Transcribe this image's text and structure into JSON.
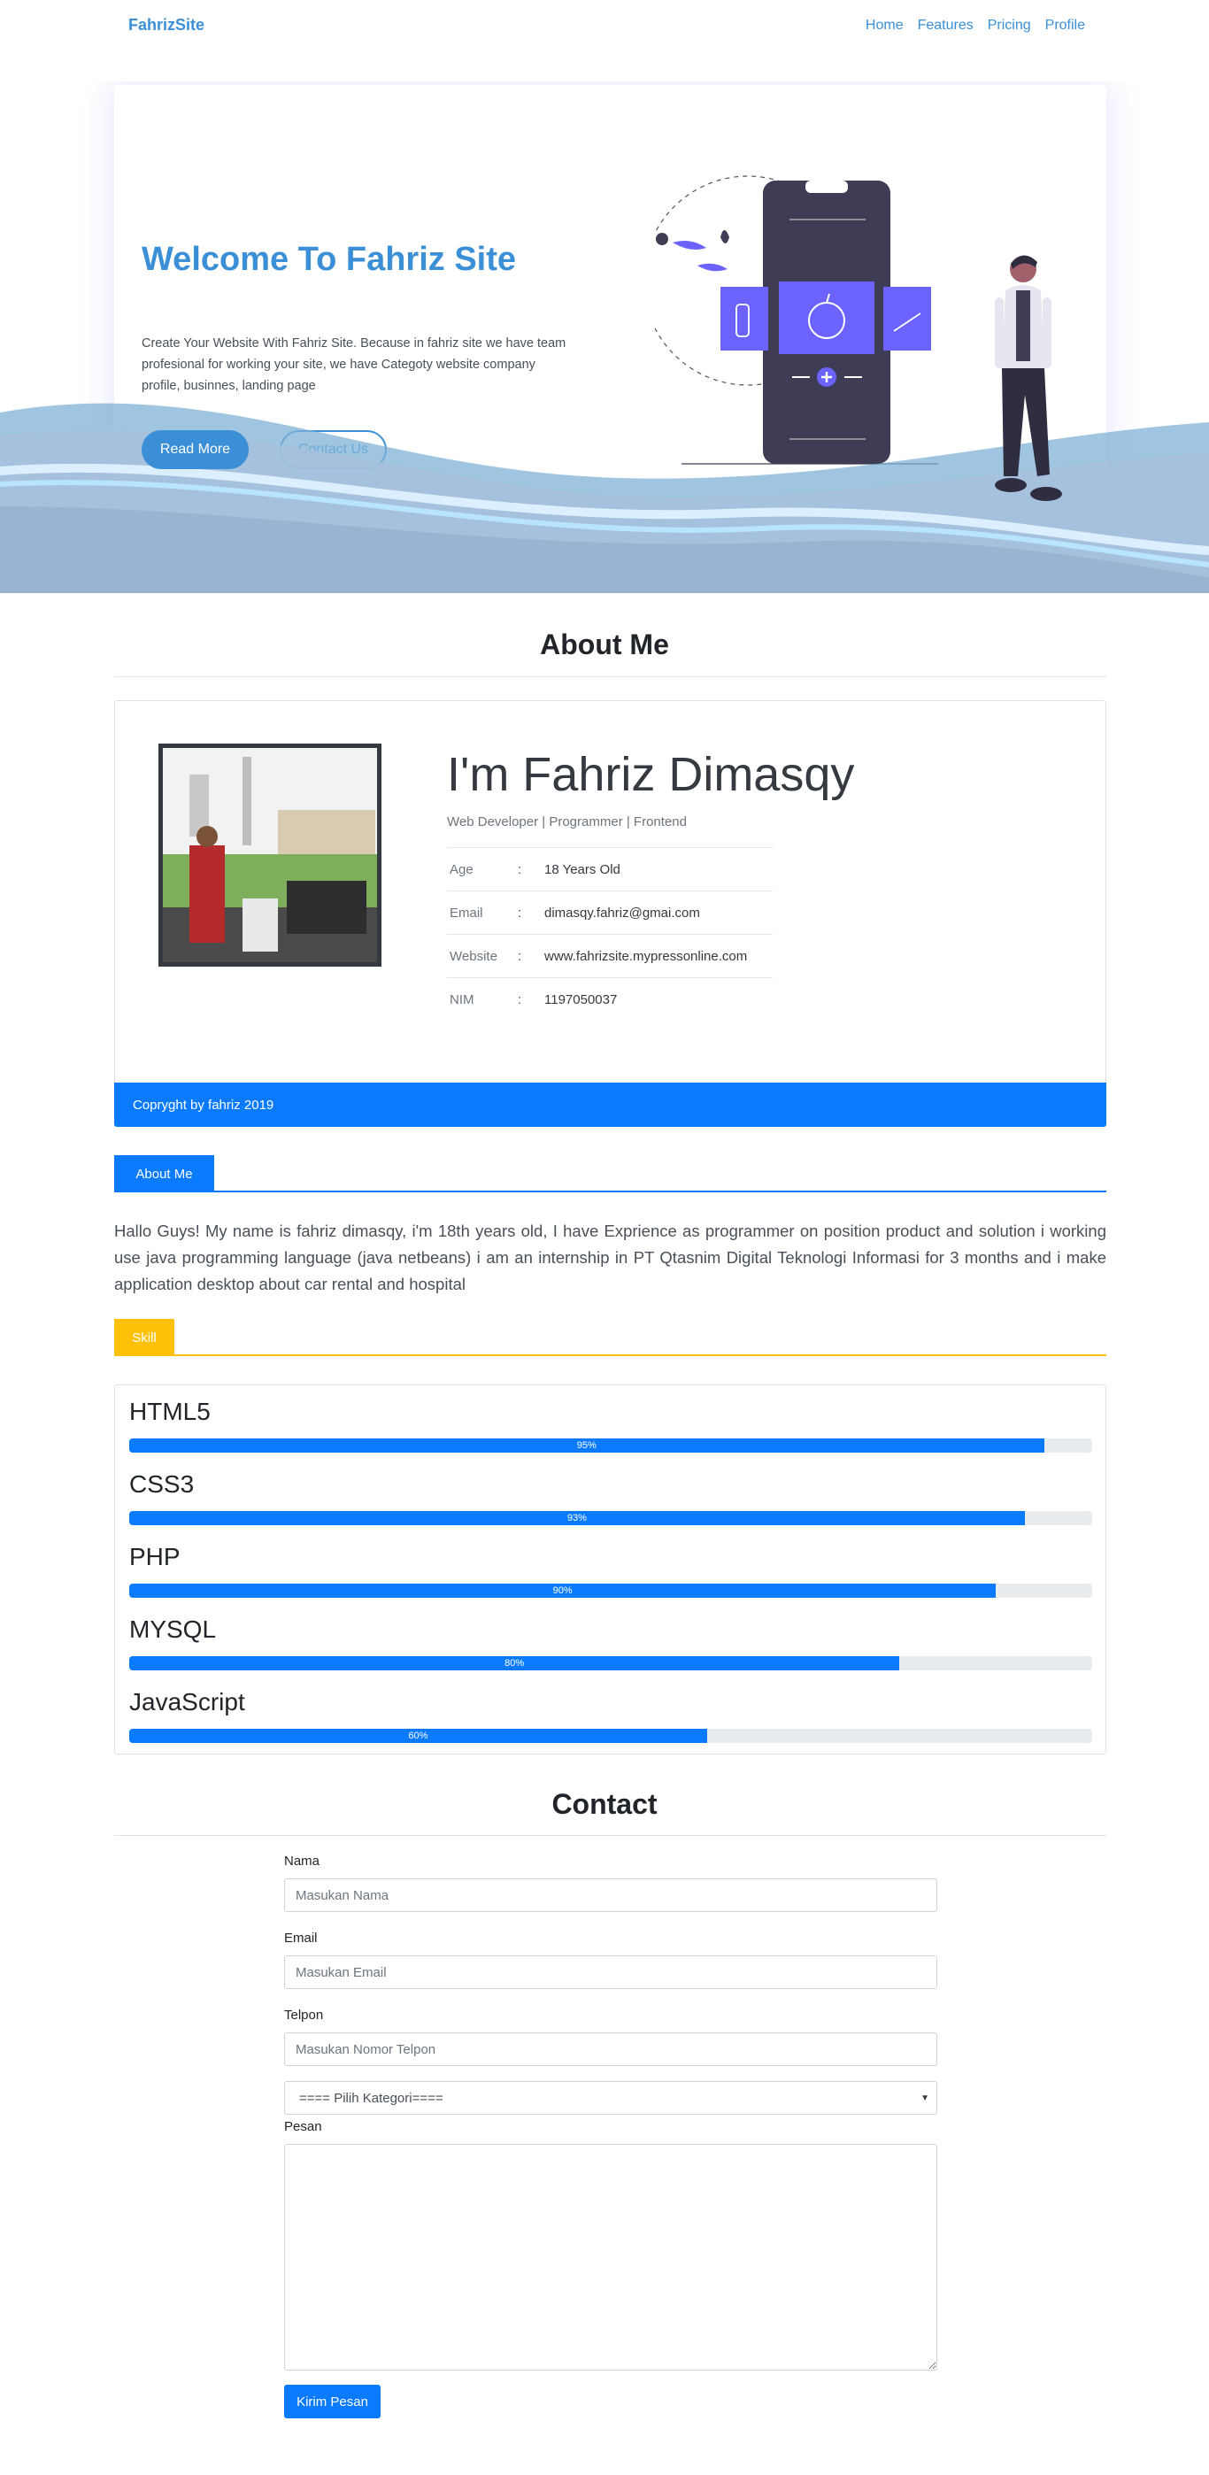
{
  "navbar": {
    "brand": "FahrizSite",
    "links": [
      "Home",
      "Features",
      "Pricing",
      "Profile"
    ]
  },
  "hero": {
    "title": "Welcome To Fahriz Site",
    "description": "Create Your Website With Fahriz Site. Because in fahriz site we have team profesional for working your site, we have Categoty website company profile, businnes, landing page",
    "read_more_label": "Read More",
    "contact_label": "Contact Us"
  },
  "about_section": {
    "title": "About Me",
    "name": "I'm Fahriz Dimasqy",
    "role": "Web Developer | Programmer | Frontend",
    "info": [
      {
        "key": "Age",
        "value": "18 Years Old"
      },
      {
        "key": "Email",
        "value": "dimasqy.fahriz@gmai.com"
      },
      {
        "key": "Website",
        "value": "www.fahrizsite.mypressonline.com"
      },
      {
        "key": "NIM",
        "value": "1197050037"
      }
    ],
    "colon": ":",
    "footer": "Copryght by fahriz 2019"
  },
  "about_tab": {
    "label": "About Me",
    "text": "Hallo Guys! My name is fahriz dimasqy, i'm 18th years old, I have Exprience as programmer on position product and solution i working use java programming language (java netbeans) i am an internship in PT Qtasnim Digital Teknologi Informasi for 3 months and i make application desktop about car rental and hospital"
  },
  "skill_tab": {
    "label": "Skill",
    "skills": [
      {
        "name": "HTML5",
        "value": 95,
        "label": "95%"
      },
      {
        "name": "CSS3",
        "value": 93,
        "label": "93%"
      },
      {
        "name": "PHP",
        "value": 90,
        "label": "90%"
      },
      {
        "name": "MYSQL",
        "value": 80,
        "label": "80%"
      },
      {
        "name": "JavaScript",
        "value": 60,
        "label": "60%"
      }
    ]
  },
  "contact": {
    "title": "Contact",
    "nama_label": "Nama",
    "nama_placeholder": "Masukan Nama",
    "email_label": "Email",
    "email_placeholder": "Masukan Email",
    "telpon_label": "Telpon",
    "telpon_placeholder": "Masukan Nomor Telpon",
    "kategori_selected": "==== Pilih Kategori====",
    "pesan_label": "Pesan",
    "submit_label": "Kirim Pesan"
  },
  "colors": {
    "brand": "#3a8fd6",
    "primary": "#0a7bff",
    "warning": "#ffc107"
  }
}
